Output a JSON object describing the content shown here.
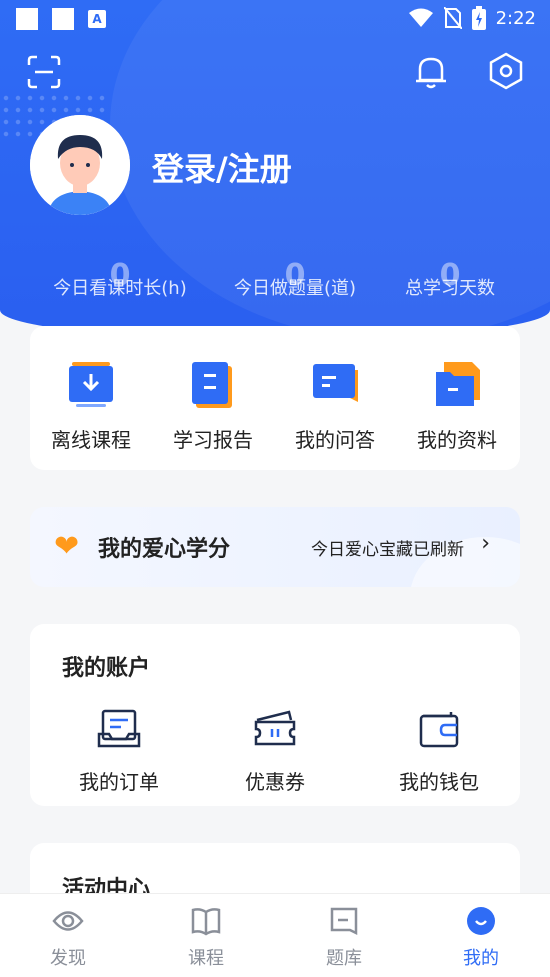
{
  "status_bar": {
    "time": "2:22"
  },
  "profile": {
    "login_text": "登录/注册"
  },
  "stats": [
    {
      "value": "0",
      "label": "今日看课时长(h)"
    },
    {
      "value": "0",
      "label": "今日做题量(道)"
    },
    {
      "value": "0",
      "label": "总学习天数"
    }
  ],
  "quick_actions": [
    {
      "label": "离线课程"
    },
    {
      "label": "学习报告"
    },
    {
      "label": "我的问答"
    },
    {
      "label": "我的资料"
    }
  ],
  "love_credits": {
    "title": "我的爱心学分",
    "subtitle": "今日爱心宝藏已刷新"
  },
  "account": {
    "title": "我的账户",
    "items": [
      {
        "label": "我的订单"
      },
      {
        "label": "优惠券"
      },
      {
        "label": "我的钱包"
      }
    ]
  },
  "activity": {
    "title": "活动中心"
  },
  "tabbar": {
    "tabs": [
      {
        "label": "发现"
      },
      {
        "label": "课程"
      },
      {
        "label": "题库"
      },
      {
        "label": "我的"
      }
    ]
  },
  "colors": {
    "primary": "#2f6cf5",
    "heart": "#ff9a1c"
  }
}
